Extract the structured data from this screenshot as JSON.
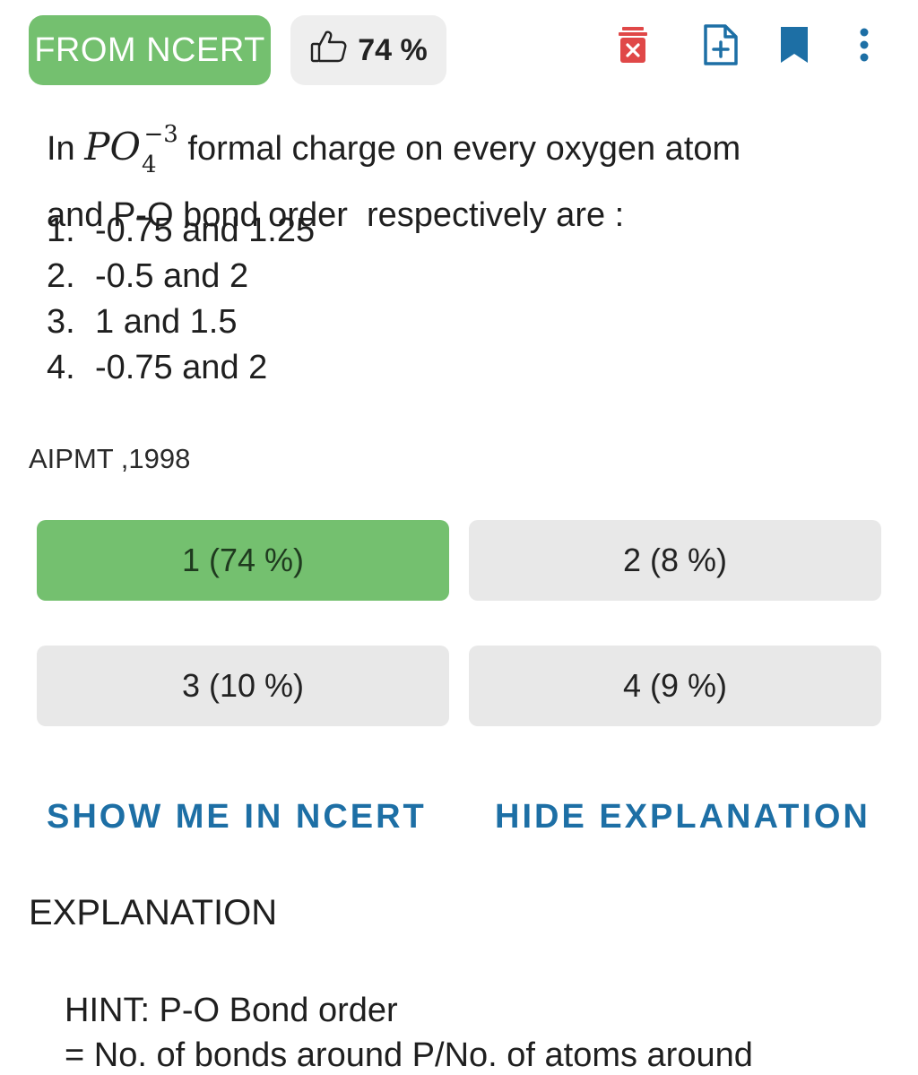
{
  "header": {
    "tag_label": "FROM NCERT",
    "likes": "74 %",
    "icons": [
      "thumbs-up-icon",
      "delete-report-icon",
      "add-note-icon",
      "bookmark-icon",
      "more-vertical-icon"
    ]
  },
  "question": {
    "prefix": "In",
    "formula_base": "PO",
    "formula_sub": "4",
    "formula_sup": "−3",
    "text_line1": "formal charge on every oxygen atom",
    "text_line2": "and P-O bond order  respectively are :",
    "options": [
      {
        "num": "1.",
        "text": "-0.75 and 1.25"
      },
      {
        "num": "2.",
        "text": "-0.5 and 2"
      },
      {
        "num": "3.",
        "text": "1 and 1.5"
      },
      {
        "num": "4.",
        "text": "-0.75 and 2"
      }
    ],
    "source": "AIPMT ,1998"
  },
  "answers": [
    {
      "label": "1 (74 %)"
    },
    {
      "label": "2 (8 %)"
    },
    {
      "label": "3 (10 %)"
    },
    {
      "label": "4 (9 %)"
    }
  ],
  "actions": {
    "show_ncert": "SHOW ME IN NCERT",
    "hide_explanation": "HIDE EXPLANATION"
  },
  "explanation": {
    "title": "EXPLANATION",
    "hint": "HINT: P-O Bond order",
    "next_line": "= No. of bonds around P/No. of atoms around"
  },
  "colors": {
    "accent_green": "#74c06f",
    "action_blue": "#1d6fa5",
    "danger_red": "#e04848"
  }
}
